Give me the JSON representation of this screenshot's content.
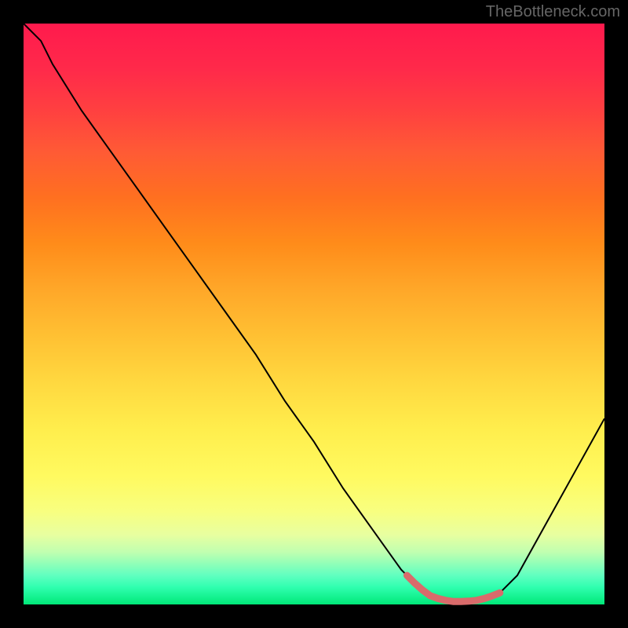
{
  "watermark": "TheBottleneck.com",
  "chart_data": {
    "type": "line",
    "title": "",
    "xlabel": "",
    "ylabel": "",
    "xlim": [
      0,
      100
    ],
    "ylim": [
      0,
      100
    ],
    "series": [
      {
        "name": "curve",
        "x": [
          0,
          3,
          5,
          10,
          15,
          20,
          25,
          30,
          35,
          40,
          45,
          50,
          55,
          60,
          65,
          68,
          70,
          72,
          74,
          76,
          78,
          80,
          82,
          85,
          90,
          95,
          100
        ],
        "values": [
          100,
          97,
          93,
          85,
          78,
          71,
          64,
          57,
          50,
          43,
          35,
          28,
          20,
          13,
          6,
          3,
          1.5,
          0.8,
          0.5,
          0.5,
          0.7,
          1.2,
          2,
          5,
          14,
          23,
          32
        ]
      }
    ],
    "annotations": [
      {
        "name": "minimum-band",
        "x_start": 66,
        "x_end": 82,
        "y": 1.5,
        "color": "#e06666"
      }
    ]
  }
}
